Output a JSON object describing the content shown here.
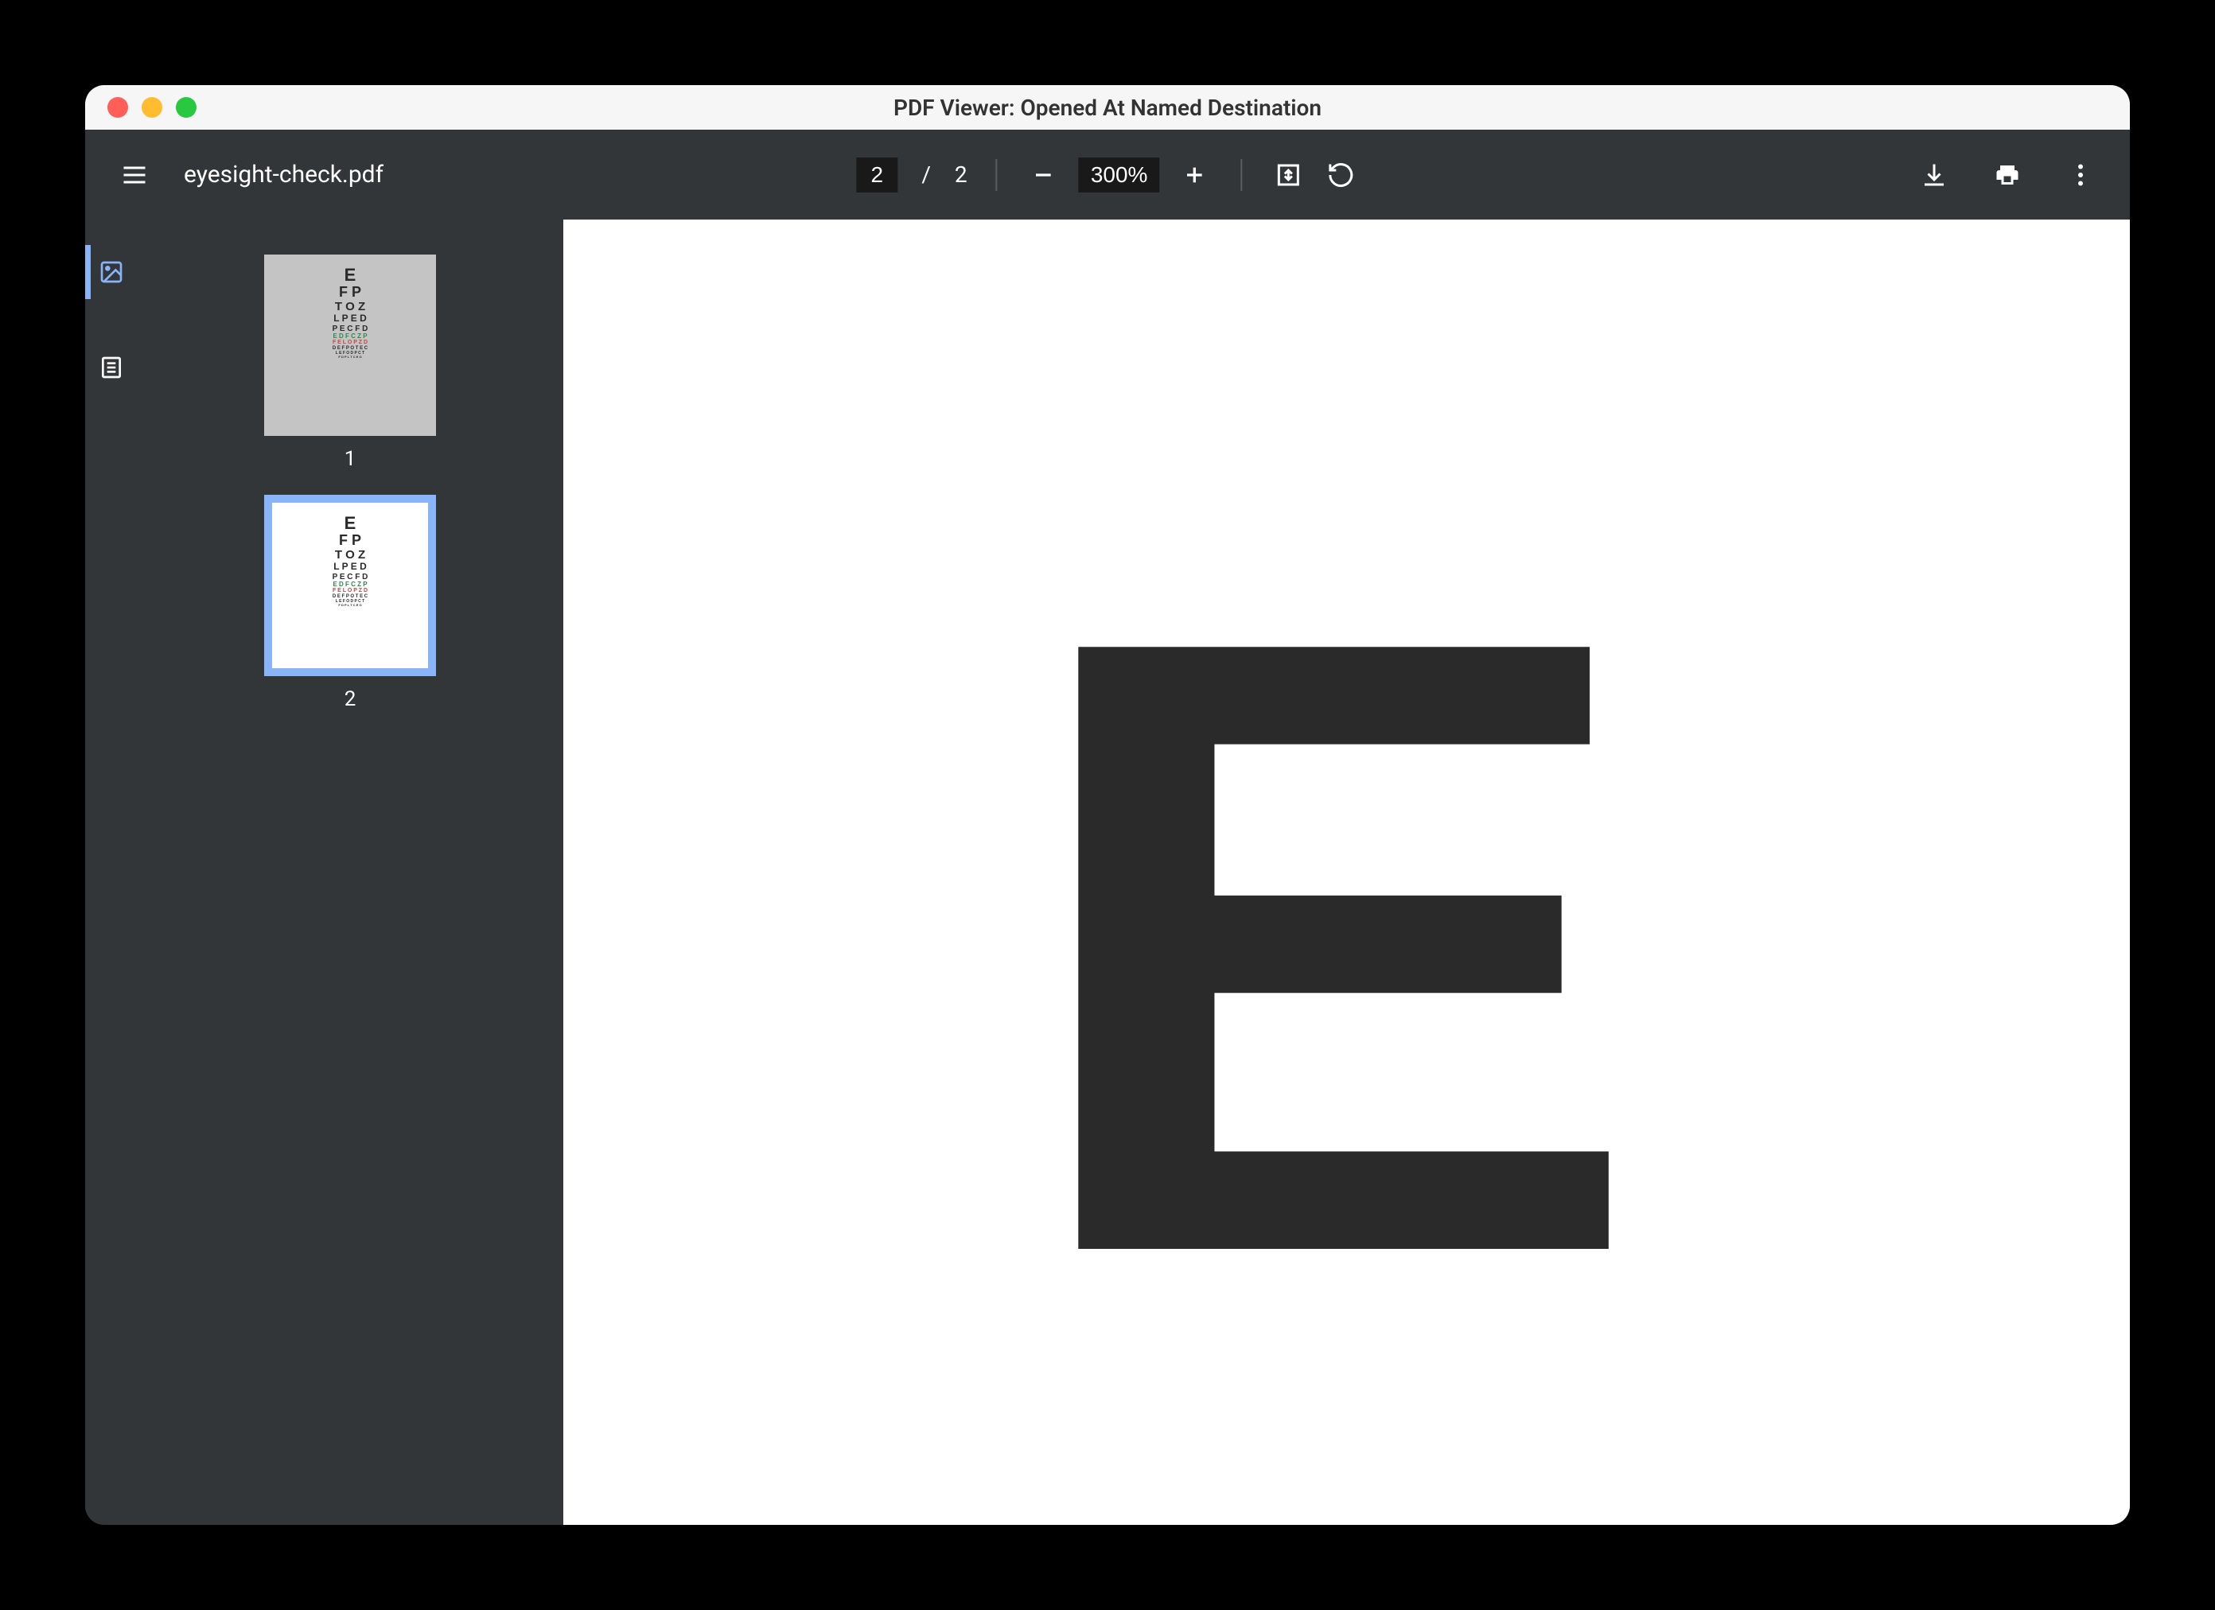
{
  "window": {
    "title": "PDF Viewer: Opened At Named Destination"
  },
  "toolbar": {
    "filename": "eyesight-check.pdf",
    "current_page": "2",
    "page_separator": "/",
    "total_pages": "2",
    "zoom_level": "300%"
  },
  "sidebar": {
    "thumbnails": [
      {
        "number": "1",
        "active": false
      },
      {
        "number": "2",
        "active": true
      }
    ]
  },
  "eye_chart": {
    "rows": [
      "E",
      "F P",
      "T O Z",
      "L P E D",
      "P E C F D",
      "E D F C Z P",
      "F E L O P Z D",
      "D E F P O T E C",
      "L E F O D P C T",
      "F D P L T C E O"
    ]
  },
  "main_content": {
    "letter": "E"
  }
}
